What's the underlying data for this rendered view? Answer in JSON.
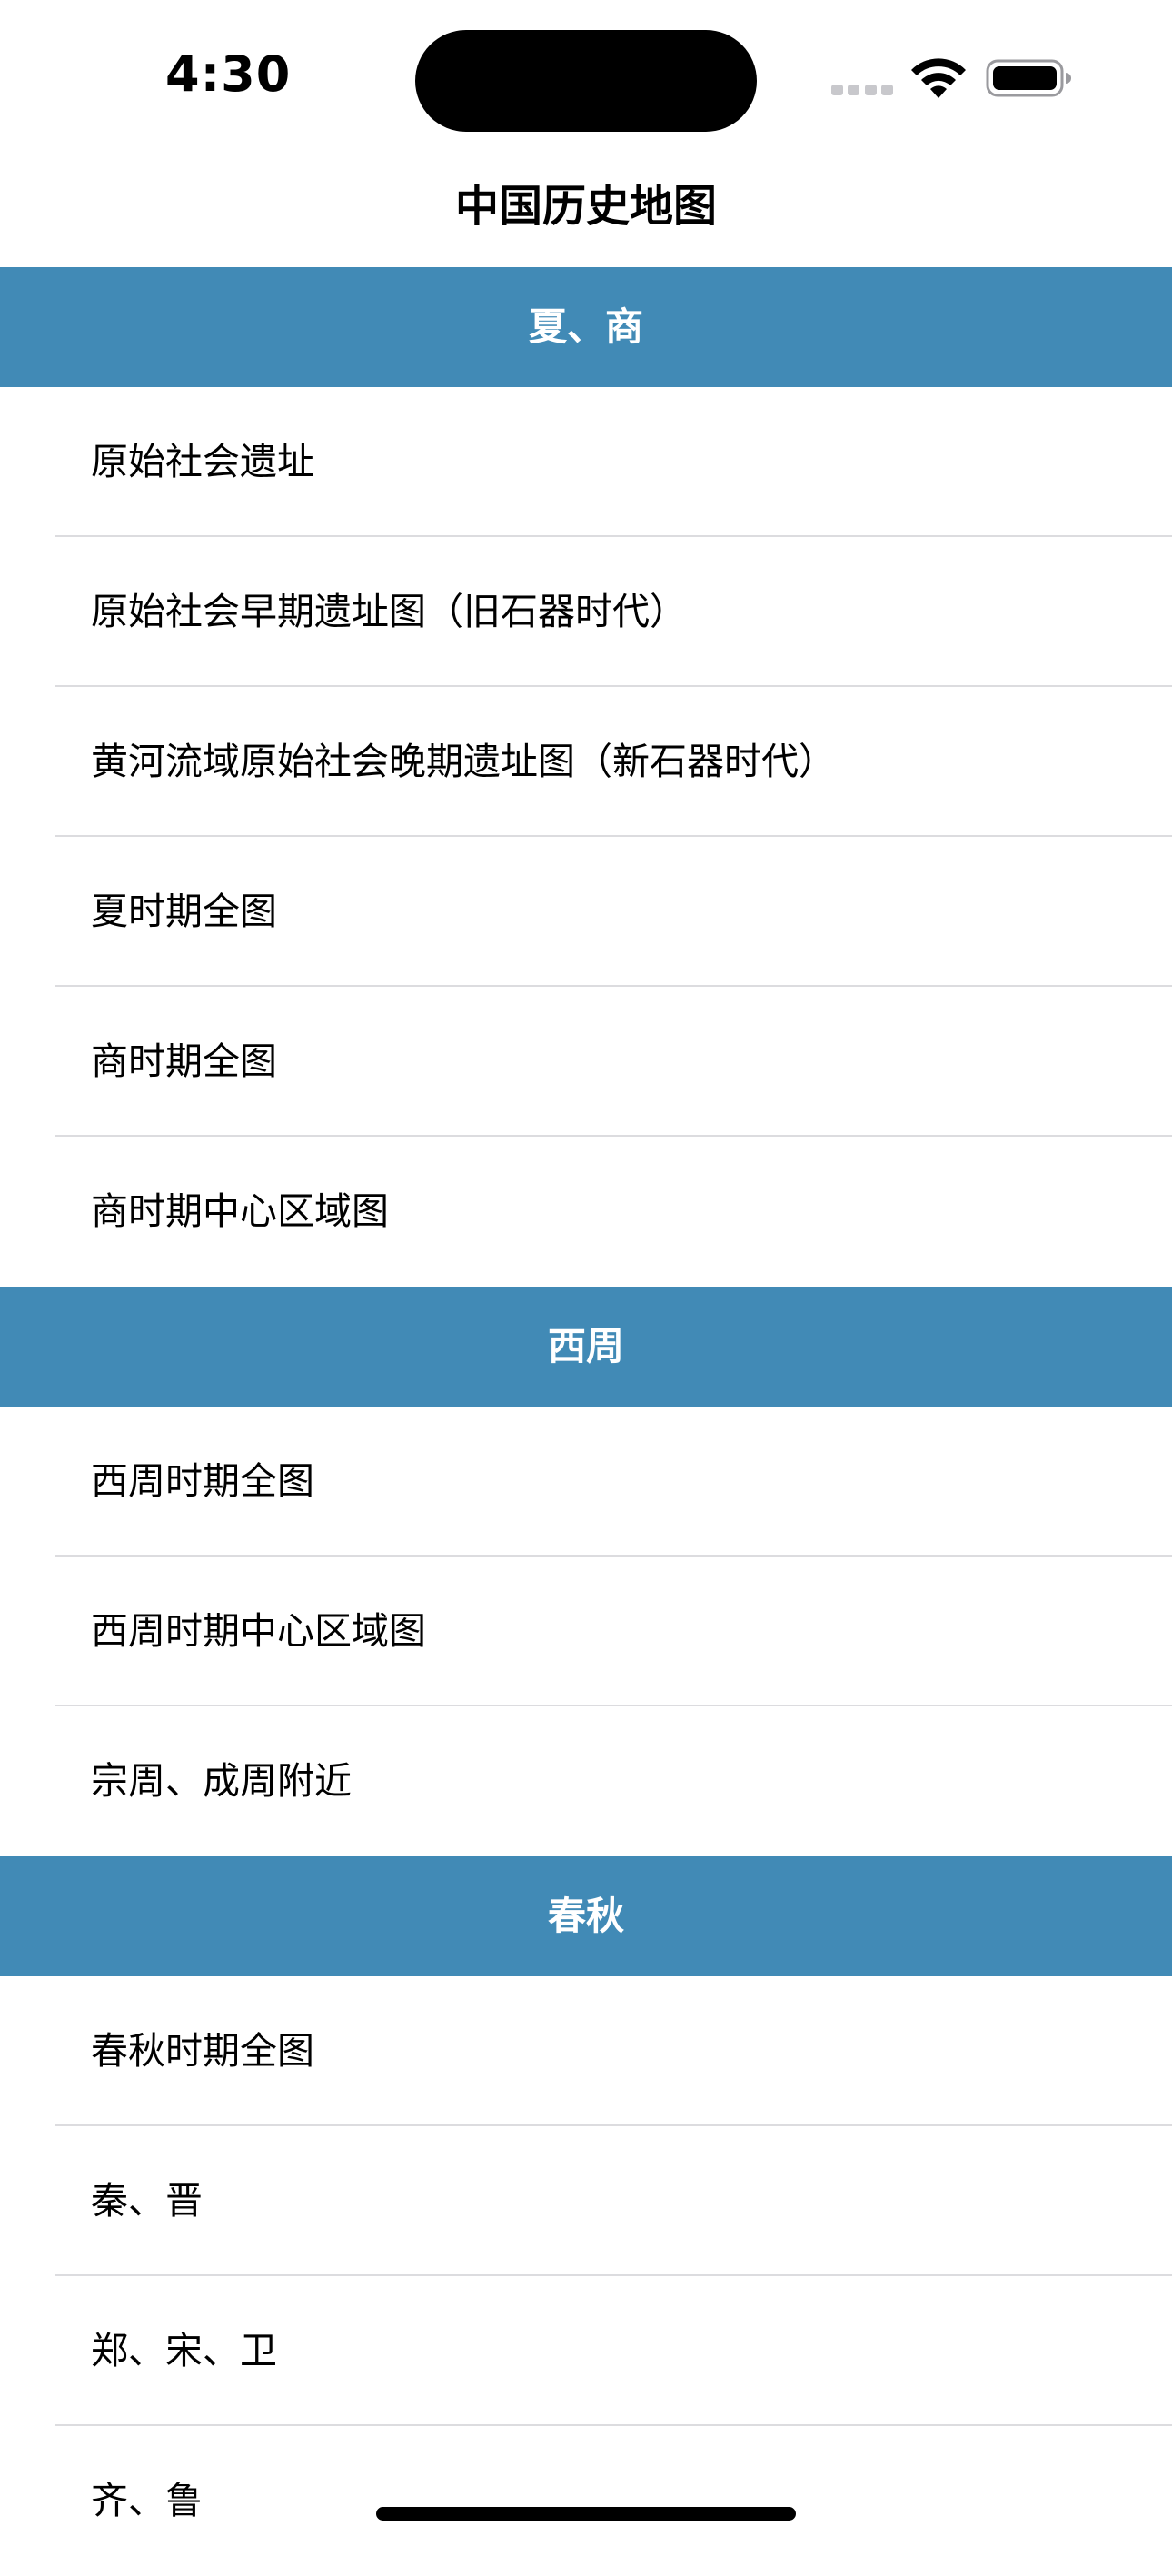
{
  "status_bar": {
    "time": "4:30"
  },
  "nav": {
    "title": "中国历史地图"
  },
  "sections": [
    {
      "header": "夏、商",
      "items": [
        "原始社会遗址",
        "原始社会早期遗址图（旧石器时代）",
        "黄河流域原始社会晚期遗址图（新石器时代）",
        "夏时期全图",
        "商时期全图",
        "商时期中心区域图"
      ]
    },
    {
      "header": "西周",
      "items": [
        "西周时期全图",
        "西周时期中心区域图",
        "宗周、成周附近"
      ]
    },
    {
      "header": "春秋",
      "items": [
        "春秋时期全图",
        "秦、晋",
        "郑、宋、卫",
        "齐、鲁"
      ]
    }
  ],
  "icons": {
    "wifi": "wifi-icon",
    "battery": "battery-icon",
    "cellular": "cellular-signal-icon"
  },
  "colors": {
    "section_header_bg": "#418ab6",
    "section_header_text": "#ffffff",
    "separator": "#dcdcdf"
  }
}
